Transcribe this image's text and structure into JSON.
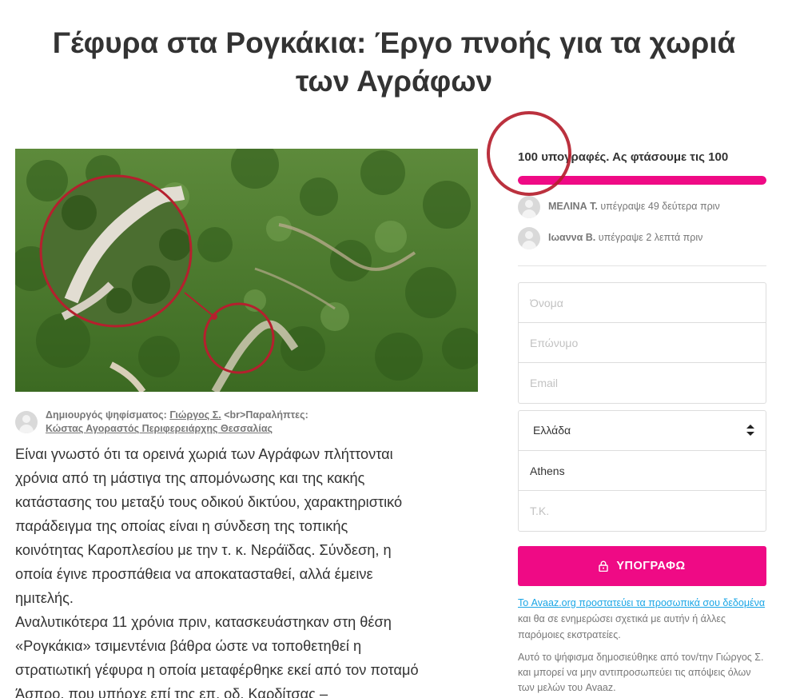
{
  "title_lines": [
    "Γέφυρα στα Ρογκάκια: Έργο πνοής για τα χωριά",
    "των Αγράφων"
  ],
  "colors": {
    "accent": "#ef0a85",
    "link": "#1aa6e6",
    "annotation_red": "#b5202e",
    "text": "#333333",
    "muted": "#777777"
  },
  "photo": {
    "icon": "petition-photo"
  },
  "creator": {
    "prefix": "Δημιουργός ψηφίσματος:",
    "name": "Γιώργος Σ.",
    "middle": "<br>Παραλήπτες:",
    "recipients": "Κώστας Αγοραστός Περιφερειάρχης Θεσσαλίας"
  },
  "body_text": "Είναι γνωστό ότι τα ορεινά χωριά των Αγράφων πλήττονται\nχρόνια από τη μάστιγα της απομόνωσης και της κακής\nκατάστασης του μεταξύ τους οδικού δικτύου, χαρακτηριστικό\nπαράδειγμα της οποίας είναι η σύνδεση της τοπικής\nκοινότητας Καροπλεσίου με την τ. κ. Νεράϊδας. Σύνδεση, η\nοποία έγινε προσπάθεια να αποκατασταθεί, αλλά έμεινε\nημιτελής.\n Αναλυτικότερα 11 χρόνια πριν, κατασκευάστηκαν στη θέση\n«Ρογκάκια» τσιμεντένια βάθρα ώστε να τοποθετηθεί η\nστρατιωτική γέφυρα η οποία μεταφέρθηκε εκεί από τον ποταμό\nΆσπρο, που υπήρχε επί της επ. οδ. Καρδίτσας –",
  "progress": {
    "label": "100 υπογραφές. Ας φτάσουμε τις 100",
    "signatures": 100,
    "goal": 100
  },
  "recent_signers": [
    {
      "name": "ΜΕΛΙΝΑ Τ.",
      "action": "υπέγραψε 49 δεύτερα πριν"
    },
    {
      "name": "Ιωαννα Β.",
      "action": "υπέγραψε 2 λεπτά πριν"
    }
  ],
  "form": {
    "first_name_placeholder": "Όνομα",
    "last_name_placeholder": "Επώνυμο",
    "email_placeholder": "Email",
    "country": "Ελλάδα",
    "city": "Athens",
    "postcode_placeholder": "Τ.Κ."
  },
  "sign_button": {
    "label": "ΥΠΟΓΡΑΦΩ",
    "icon": "lock-icon"
  },
  "privacy": {
    "link_text": "Το Avaaz.org προστατεύει τα προσωπικά σου δεδομένα",
    "rest": " και θα σε ενημερώσει σχετικά με αυτήν ή άλλες παρόμοιες εκστρατείες."
  },
  "disclaimer": "Αυτό το ψήφισμα δημοσιεύθηκε από τον/την Γιώργος Σ. και μπορεί να μην αντιπροσωπεύει τις απόψεις όλων των μελών του Avaaz."
}
